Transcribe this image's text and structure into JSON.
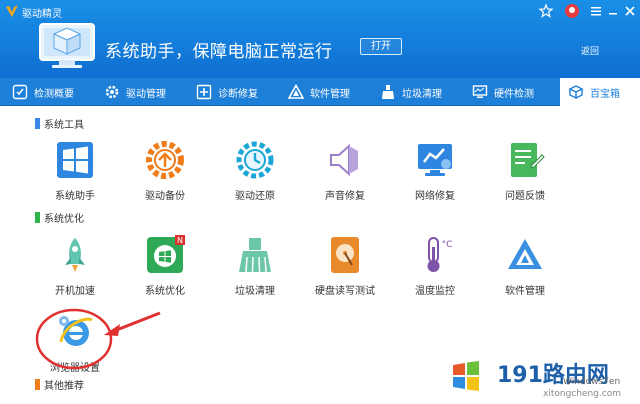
{
  "app": {
    "title": "驱动精灵"
  },
  "banner": {
    "text": "系统助手，保障电脑正常运行",
    "open_label": "打开",
    "back_label": "返回"
  },
  "tabs": [
    {
      "label": "检测概要"
    },
    {
      "label": "驱动管理"
    },
    {
      "label": "诊断修复"
    },
    {
      "label": "软件管理"
    },
    {
      "label": "垃圾清理"
    },
    {
      "label": "硬件检测"
    },
    {
      "label": "百宝箱",
      "active": true
    }
  ],
  "sections": [
    {
      "title": "系统工具",
      "color": "#3a86e8"
    },
    {
      "title": "系统优化",
      "color": "#2fb34a"
    },
    {
      "title": "其他推荐",
      "color": "#f07d1a"
    }
  ],
  "tools_system": [
    {
      "label": "系统助手",
      "icon": "windows-icon"
    },
    {
      "label": "驱动备份",
      "icon": "backup-gear-icon"
    },
    {
      "label": "驱动还原",
      "icon": "restore-clock-icon"
    },
    {
      "label": "声音修复",
      "icon": "speaker-icon"
    },
    {
      "label": "网络修复",
      "icon": "network-monitor-icon"
    },
    {
      "label": "问题反馈",
      "icon": "feedback-note-icon"
    }
  ],
  "tools_optimize": [
    {
      "label": "开机加速",
      "icon": "rocket-icon"
    },
    {
      "label": "系统优化",
      "icon": "system-optimize-icon"
    },
    {
      "label": "垃圾清理",
      "icon": "broom-icon"
    },
    {
      "label": "硬盘读写测试",
      "icon": "harddisk-icon"
    },
    {
      "label": "温度监控",
      "icon": "thermometer-icon"
    },
    {
      "label": "软件管理",
      "icon": "software-triangle-icon"
    },
    {
      "label": "浏览器设置",
      "icon": "ie-browser-icon"
    }
  ],
  "watermark": {
    "brand": "191路由网",
    "site": "Windows7en",
    "url": "xitongcheng.com"
  },
  "colors": {
    "header": "#1a8fe6",
    "tabbar": "#1e7fd8",
    "arrow": "#e03030"
  }
}
